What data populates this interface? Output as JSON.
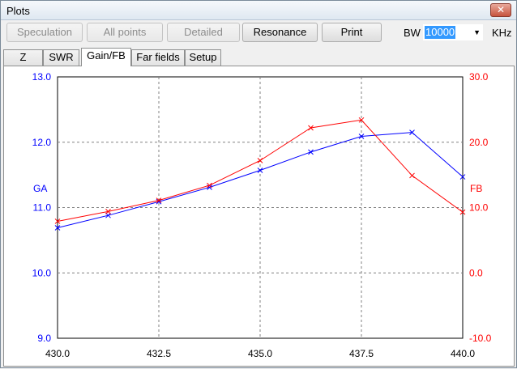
{
  "window": {
    "title": "Plots",
    "close_label": "✕"
  },
  "toolbar": {
    "buttons": [
      {
        "label": "Speculation",
        "enabled": false
      },
      {
        "label": "All points",
        "enabled": false
      },
      {
        "label": "Detailed",
        "enabled": false
      },
      {
        "label": "Resonance",
        "enabled": true
      },
      {
        "label": "Print",
        "enabled": true
      }
    ],
    "bw_label": "BW",
    "bw_value": "10000",
    "bw_unit": "KHz"
  },
  "tabs": [
    {
      "label": "Z",
      "active": false
    },
    {
      "label": "SWR",
      "active": false
    },
    {
      "label": "Gain/FB",
      "active": true
    },
    {
      "label": "Far fields",
      "active": false
    },
    {
      "label": "Setup",
      "active": false
    }
  ],
  "chart_data": {
    "type": "line",
    "grid": true,
    "x": [
      430.0,
      431.25,
      432.5,
      433.75,
      435.0,
      436.25,
      437.5,
      438.75,
      440.0
    ],
    "x_ticks": [
      "430.0",
      "432.5",
      "435.0",
      "437.5",
      "440.0"
    ],
    "x_tick_values": [
      430.0,
      432.5,
      435.0,
      437.5,
      440.0
    ],
    "xlim": [
      430.0,
      440.0
    ],
    "left_axis": {
      "label": "GA",
      "color": "#0000ff",
      "ylim": [
        9.0,
        13.0
      ],
      "ticks": [
        "9.0",
        "10.0",
        "11.0",
        "12.0",
        "13.0"
      ],
      "tick_values": [
        9,
        10,
        11,
        12,
        13
      ]
    },
    "right_axis": {
      "label": "FB",
      "color": "#ff0000",
      "ylim": [
        -10.0,
        30.0
      ],
      "ticks": [
        "-10.0",
        "0.0",
        "10.0",
        "20.0",
        "30.0"
      ],
      "tick_values": [
        -10,
        0,
        10,
        20,
        30
      ]
    },
    "series": [
      {
        "axis": "left",
        "color": "#0000ff",
        "values": [
          10.69,
          10.88,
          11.09,
          11.31,
          11.57,
          11.85,
          12.09,
          12.15,
          11.47
        ]
      },
      {
        "axis": "right",
        "color": "#ff0000",
        "values": [
          7.9,
          9.4,
          11.1,
          13.4,
          17.2,
          22.2,
          23.4,
          14.9,
          9.3
        ]
      }
    ]
  }
}
